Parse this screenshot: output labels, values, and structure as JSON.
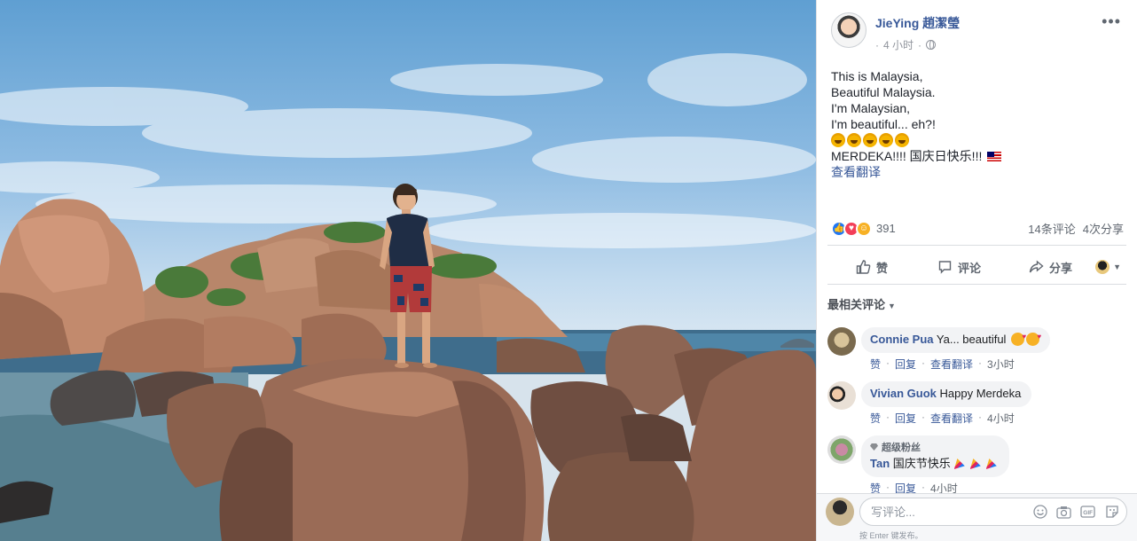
{
  "post": {
    "author": "JieYing 趙潔瑩",
    "time": "4 小时",
    "lines": [
      "This is Malaysia,",
      "Beautiful Malaysia.",
      "I'm Malaysian,",
      "I'm beautiful... eh?!",
      "MERDEKA!!!! 国庆日快乐!!!"
    ],
    "see_translation": "查看翻译",
    "reaction_count": "391",
    "comments_count": "14条评论",
    "shares_count": "4次分享"
  },
  "actions": {
    "like": "赞",
    "comment": "评论",
    "share": "分享"
  },
  "sort_label": "最相关评论",
  "comments": [
    {
      "name": "Connie Pua",
      "text": "Ya... beautiful",
      "like": "赞",
      "reply": "回复",
      "translate": "查看翻译",
      "time": "3小时"
    },
    {
      "name": "Vivian Guok",
      "text": "Happy Merdeka",
      "like": "赞",
      "reply": "回复",
      "translate": "查看翻译",
      "time": "4小时"
    },
    {
      "badge": "超级粉丝",
      "name": "Tan",
      "text": "国庆节快乐",
      "like": "赞",
      "reply": "回复",
      "time": "4小时"
    }
  ],
  "composer": {
    "placeholder": "写评论...",
    "hint": "按 Enter 键发布。"
  },
  "colors": {
    "link": "#385898",
    "like_blue": "#2078f4",
    "love_red": "#f33e58",
    "haha_yellow": "#f7b125"
  }
}
